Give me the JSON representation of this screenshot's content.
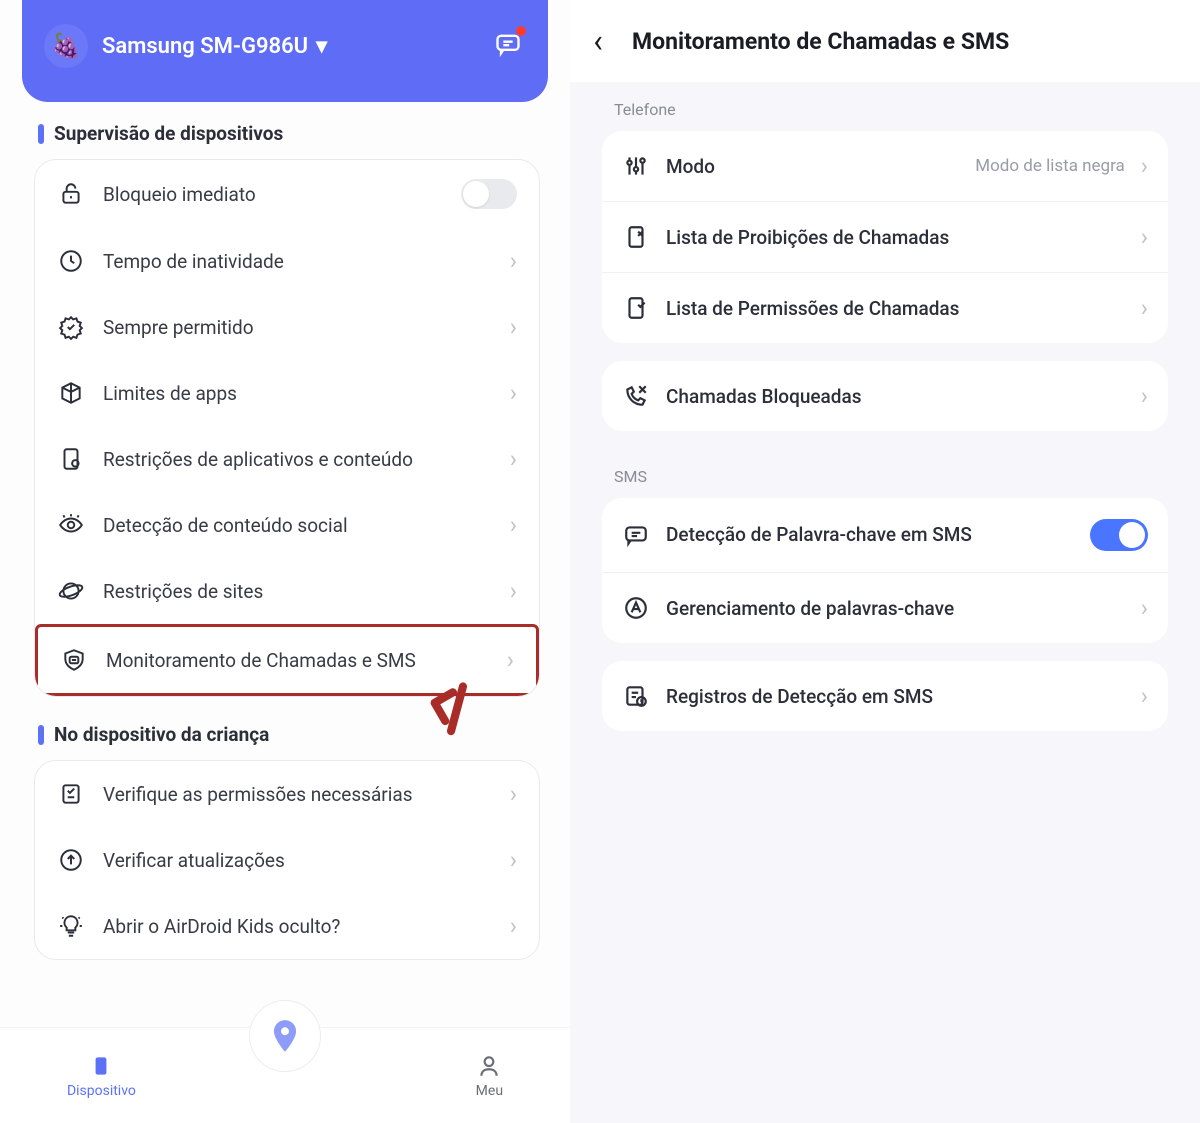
{
  "left": {
    "device_name": "Samsung SM-G986U",
    "sections": {
      "supervision": {
        "title": "Supervisão de dispositivos",
        "items": {
          "lock": "Bloqueio imediato",
          "downtime": "Tempo de inatividade",
          "always_allowed": "Sempre permitido",
          "app_limits": "Limites de apps",
          "content_restrict": "Restrições de aplicativos e conteúdo",
          "social_detect": "Detecção de conteúdo social",
          "site_restrict": "Restrições de sites",
          "call_sms": "Monitoramento de Chamadas e SMS"
        }
      },
      "child_device": {
        "title": "No dispositivo da criança",
        "items": {
          "check_perms": "Verifique as permissões necessárias",
          "check_updates": "Verificar atualizações",
          "hidden_kids": "Abrir o AirDroid Kids oculto?"
        }
      }
    },
    "nav": {
      "device": "Dispositivo",
      "me": "Meu"
    }
  },
  "right": {
    "title": "Monitoramento de Chamadas e SMS",
    "phone_header": "Telefone",
    "sms_header": "SMS",
    "mode_label": "Modo",
    "mode_value": "Modo de lista negra",
    "block_list": "Lista de Proibições de Chamadas",
    "allow_list": "Lista de Permissões de Chamadas",
    "blocked_calls": "Chamadas Bloqueadas",
    "keyword_detect": "Detecção de Palavra-chave em SMS",
    "keyword_mgmt": "Gerenciamento de palavras-chave",
    "sms_logs": "Registros de Detecção em SMS"
  }
}
